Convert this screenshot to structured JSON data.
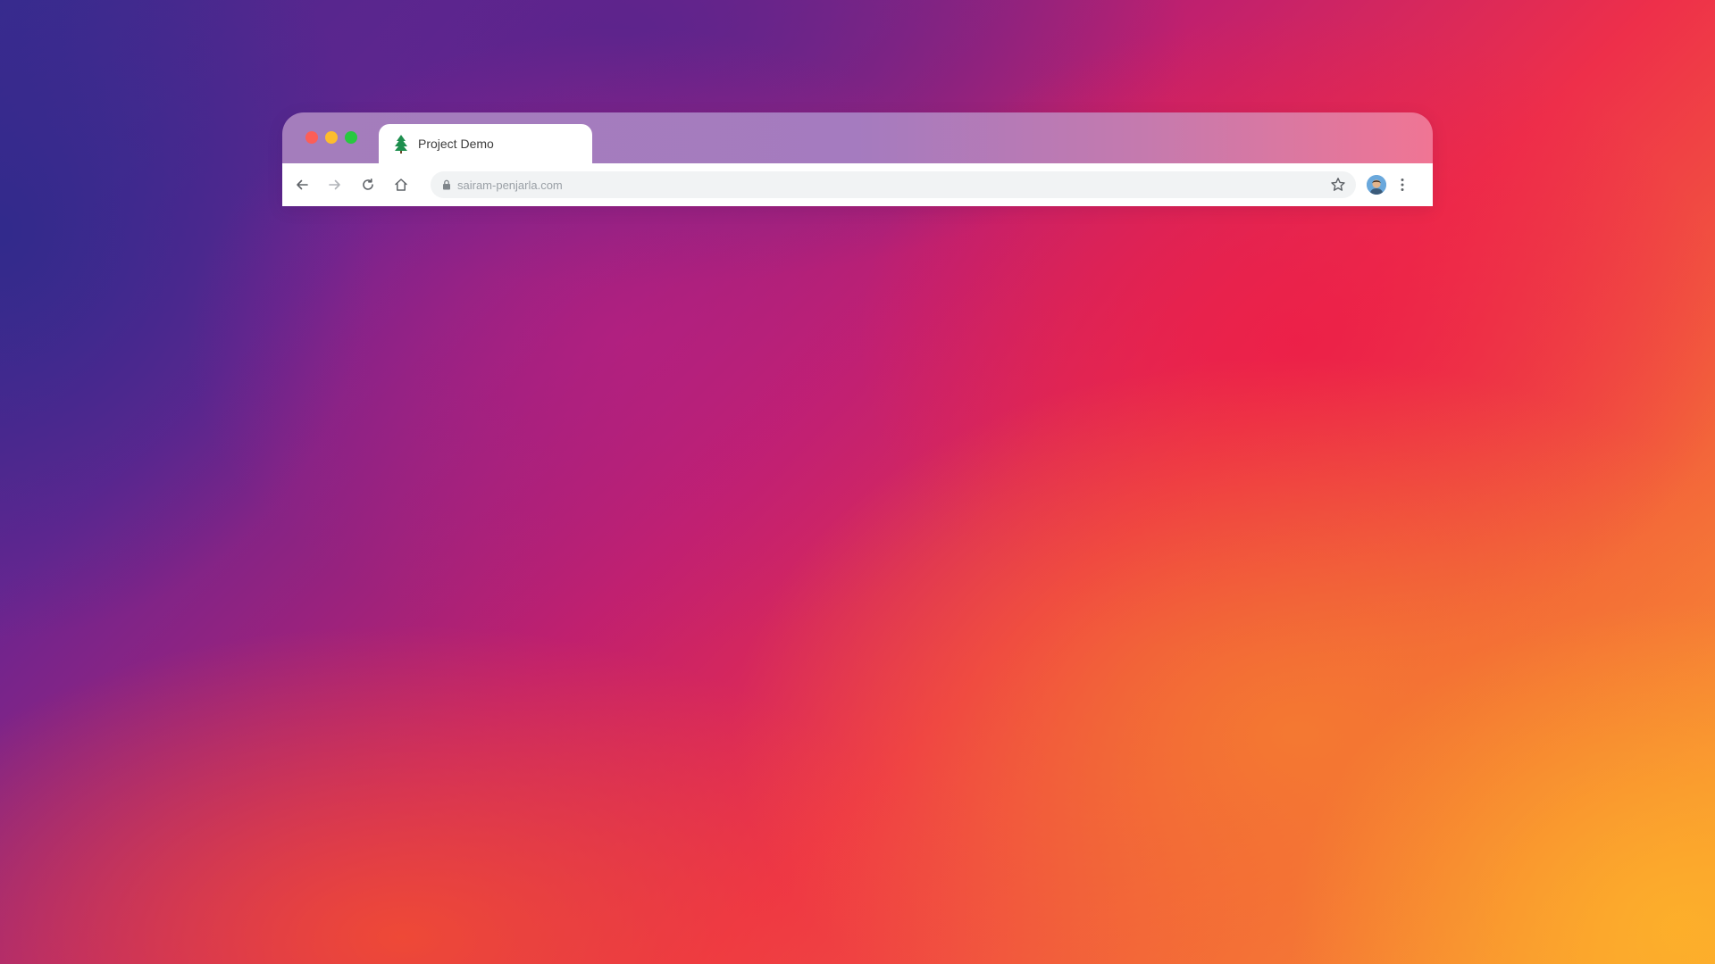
{
  "browser": {
    "tab": {
      "title": "Project Demo",
      "favicon": "tree-icon"
    },
    "toolbar": {
      "back_icon": "back-arrow-icon",
      "forward_icon": "forward-arrow-icon",
      "reload_icon": "reload-icon",
      "home_icon": "home-icon",
      "url": "sairam-penjarla.com",
      "lock_icon": "lock-icon",
      "bookmark_icon": "star-icon",
      "profile_icon": "avatar",
      "menu_icon": "kebab-menu-icon"
    },
    "window_controls": [
      "close",
      "minimize",
      "maximize"
    ]
  },
  "colors": {
    "close": "#fc5e57",
    "minimize": "#fdbc2e",
    "maximize": "#28c840",
    "favicon": "#1e8f4e"
  }
}
